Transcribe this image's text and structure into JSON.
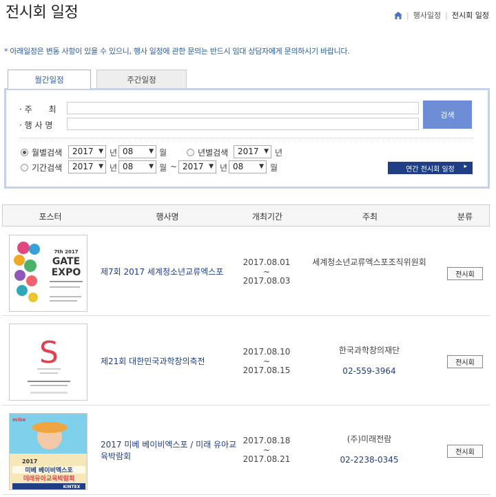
{
  "page": {
    "title": "전시회 일정"
  },
  "breadcrumb": {
    "items": [
      "행사일정",
      "전시회 일정"
    ]
  },
  "notice": "* 아래일정은 변동 사항이 있을 수 있으니, 행사 일정에 관한 문의는 반드시 임대 상담자에게 문의하시기 바랍니다.",
  "tabs": {
    "monthly": "월간일정",
    "weekly": "주간일정"
  },
  "search": {
    "host_label": "· 주　　최",
    "event_label": "· 행 사 명",
    "host_value": "",
    "event_value": "",
    "button": "검색",
    "monthly_label": "월별검색",
    "yearly_label": "년별검색",
    "period_label": "기간검색",
    "month_year": "2017",
    "month_month": "08",
    "yearly_year": "2017",
    "period_from_year": "2017",
    "period_from_month": "08",
    "period_to_year": "2017",
    "period_to_month": "08",
    "unit_year": "년",
    "unit_month": "월",
    "tilde": "~",
    "annual_button": "연간 전시회 일정"
  },
  "table": {
    "headers": [
      "포스터",
      "행사명",
      "개최기간",
      "주최",
      "분류"
    ],
    "rows": [
      {
        "name": "제7회 2017 세계청소년교류엑스포",
        "start": "2017.08.01",
        "sep": "~",
        "end": "2017.08.03",
        "host": "세계청소년교류엑스포조직위원회",
        "phone": "",
        "category": "전시회",
        "poster_text": "7th 2017 GATE EXPO"
      },
      {
        "name": "제21회 대한민국과학창의축전",
        "start": "2017.08.10",
        "sep": "~",
        "end": "2017.08.15",
        "host": "한국과학창의재단",
        "phone": "02-559-3964",
        "category": "전시회",
        "poster_text": "S"
      },
      {
        "name": "2017 미베 베이비엑스포 / 미래 유아교육박람회",
        "start": "2017.08.18",
        "sep": "~",
        "end": "2017.08.21",
        "host": "(주)미래전람",
        "phone": "02-2238-0345",
        "category": "전시회",
        "poster_text": "2017 미베 베이비엑스포 미래유아교육박람회 KINTEX"
      }
    ]
  },
  "colors": {
    "accent": "#1f3e86",
    "search_button": "#6d8dd6",
    "box_border": "#c4d1e7"
  }
}
